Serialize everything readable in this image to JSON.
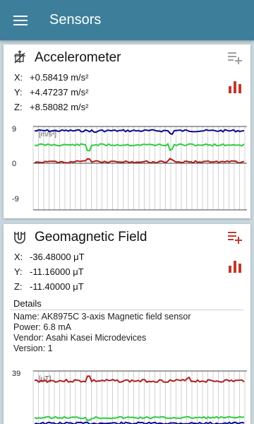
{
  "app_bar": {
    "title": "Sensors",
    "menu_icon": "menu-icon"
  },
  "cards": [
    {
      "title": "Accelerometer",
      "icon": "axis-3d-icon",
      "values": [
        {
          "axis": "X:",
          "value": "+0.58419 m/s²"
        },
        {
          "axis": "Y:",
          "value": "+4.47237 m/s²"
        },
        {
          "axis": "Z:",
          "value": "+8.58082 m/s²"
        }
      ],
      "graph": {
        "y_max_label": "9",
        "y_mid_label": "0",
        "y_min_label": "-9",
        "unit_label": "[m/s²]"
      }
    },
    {
      "title": "Geomagnetic Field",
      "icon": "magnet-icon",
      "values": [
        {
          "axis": "X:",
          "value": "-36.48000 μT"
        },
        {
          "axis": "Y:",
          "value": "-11.16000 μT"
        },
        {
          "axis": "Z:",
          "value": "-11.40000 μT"
        }
      ],
      "details": {
        "title": "Details",
        "name": "Name: AK8975C 3-axis Magnetic field sensor",
        "power": "Power: 6.8 mA",
        "vendor": "Vendor: Asahi Kasei Microdevices",
        "version": "Version: 1"
      },
      "graph": {
        "y_max_label": "39",
        "unit_label": "[μT]"
      }
    }
  ],
  "colors": {
    "app_bar": "#3d7f9a",
    "background": "#c8d6dd",
    "accent": "#c0392b",
    "series_x": "#b01e1e",
    "series_y": "#2ecc40",
    "series_z": "#0a0a8c"
  }
}
